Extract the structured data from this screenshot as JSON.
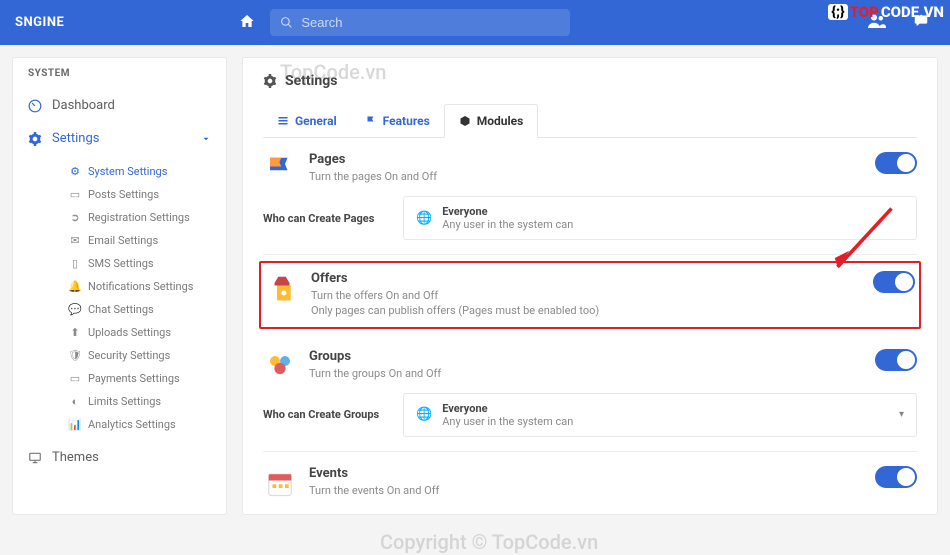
{
  "brand": "SNGINE",
  "search": {
    "placeholder": "Search"
  },
  "topcode_badge": {
    "bracket": "{;}",
    "t1": "TOP",
    "t2": "CODE.VN"
  },
  "sidebar": {
    "category": "SYSTEM",
    "items": [
      {
        "label": "Dashboard",
        "icon": "dashboard"
      },
      {
        "label": "Settings",
        "icon": "gear",
        "active": true
      }
    ],
    "sub": [
      {
        "label": "System Settings",
        "icon": "sliders",
        "sel": true
      },
      {
        "label": "Posts Settings",
        "icon": "posts"
      },
      {
        "label": "Registration Settings",
        "icon": "login"
      },
      {
        "label": "Email Settings",
        "icon": "mail"
      },
      {
        "label": "SMS Settings",
        "icon": "phone"
      },
      {
        "label": "Notifications Settings",
        "icon": "bell"
      },
      {
        "label": "Chat Settings",
        "icon": "chat"
      },
      {
        "label": "Uploads Settings",
        "icon": "upload"
      },
      {
        "label": "Security Settings",
        "icon": "shield"
      },
      {
        "label": "Payments Settings",
        "icon": "card"
      },
      {
        "label": "Limits Settings",
        "icon": "gauge"
      },
      {
        "label": "Analytics Settings",
        "icon": "chart"
      }
    ],
    "themes": "Themes"
  },
  "main": {
    "title": "Settings",
    "tabs": [
      {
        "label": "General"
      },
      {
        "label": "Features"
      },
      {
        "label": "Modules",
        "active": true
      }
    ],
    "modules": [
      {
        "name": "Pages",
        "desc": "Turn the pages On and Off",
        "extra": "",
        "setting_label": "Who can Create Pages",
        "setting_title": "Everyone",
        "setting_sub": "Any user in the system can"
      },
      {
        "name": "Offers",
        "desc": "Turn the offers On and Off",
        "extra": "Only pages can publish offers (Pages must be enabled too)",
        "highlighted": true
      },
      {
        "name": "Groups",
        "desc": "Turn the groups On and Off",
        "extra": "",
        "setting_label": "Who can Create Groups",
        "setting_title": "Everyone",
        "setting_sub": "Any user in the system can",
        "caret": true
      },
      {
        "name": "Events",
        "desc": "Turn the events On and Off",
        "extra": ""
      }
    ]
  },
  "watermarks": {
    "w1": "TopCode.vn",
    "w2": "Copyright © TopCode.vn"
  }
}
